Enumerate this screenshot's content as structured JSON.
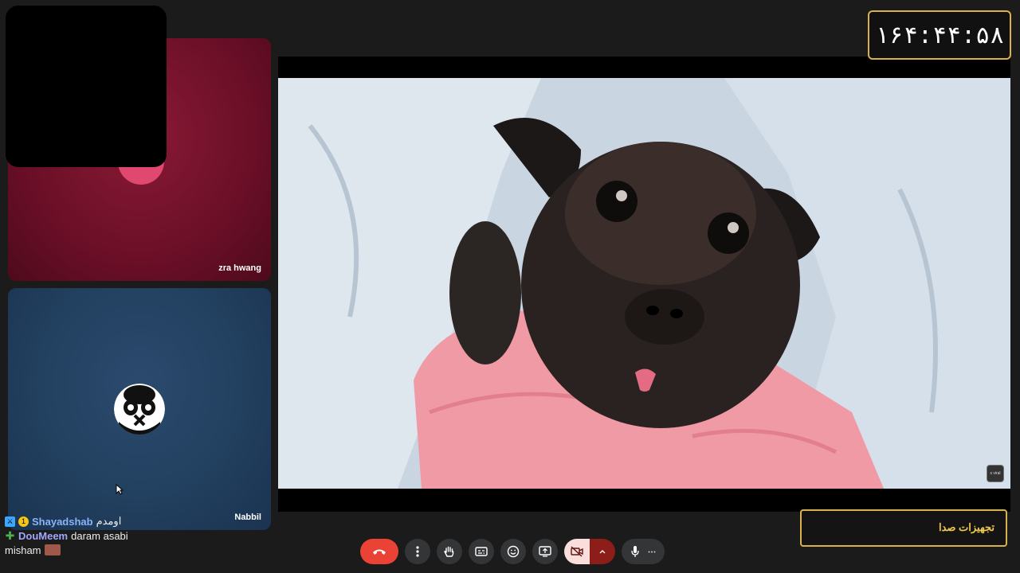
{
  "timer": {
    "value": "۱۶۴:۴۴:۵۸"
  },
  "participants": [
    {
      "name": "zra hwang"
    },
    {
      "name": "Nabbil"
    }
  ],
  "audio_panel": {
    "label": "تجهیزات صدا"
  },
  "watermark": {
    "text": "s viral"
  },
  "chat": [
    {
      "user": "Shayadshab",
      "message": "اومدم"
    },
    {
      "user": "DouMeem",
      "message": "daram asabi"
    },
    {
      "user": "misham",
      "message": ""
    }
  ],
  "colors": {
    "accent_gold": "#d9b24a",
    "end_call": "#ea4335",
    "control_bg": "#333537"
  },
  "icons": [
    "end-call-icon",
    "more-options-icon",
    "raise-hand-icon",
    "captions-icon",
    "emoji-icon",
    "present-icon",
    "camera-off-icon",
    "chevron-up-icon",
    "microphone-icon",
    "more-horizontal-icon"
  ]
}
